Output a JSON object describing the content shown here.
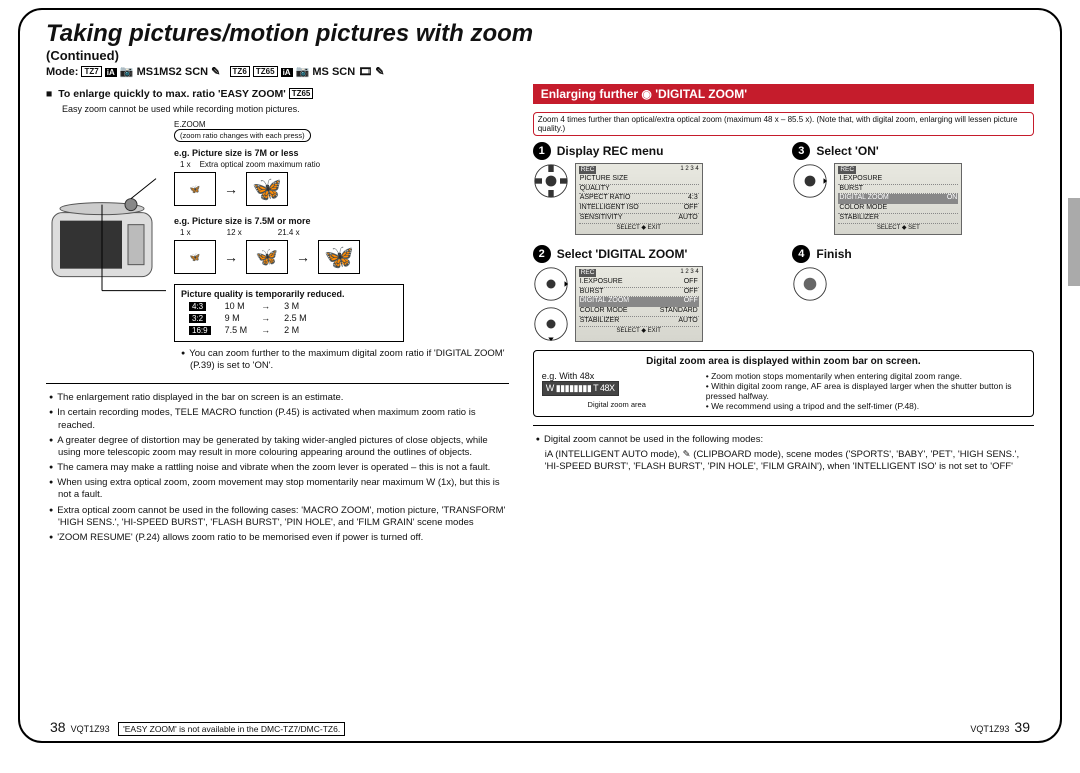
{
  "header": {
    "title": "Taking pictures/motion pictures with zoom",
    "continued": "(Continued)",
    "mode_label": "Mode:",
    "mode_set1": "MS1MS2 SCN",
    "mode_set2": "MS SCN"
  },
  "left": {
    "easy_zoom_title": "To enlarge quickly to max. ratio 'EASY ZOOM'",
    "easy_zoom_badge": "TZ65",
    "easy_zoom_note": "Easy zoom cannot be used while recording motion pictures.",
    "ezoom_label": "E.ZOOM",
    "zoom_ratio_note": "(zoom ratio changes with each press)",
    "eg1": "e.g. Picture size is 7M or less",
    "eg1_1x": "1 x",
    "eg1_cap": "Extra optical zoom maximum ratio",
    "eg2": "e.g. Picture size is 7.5M or more",
    "eg2_1": "1 x",
    "eg2_2": "12 x",
    "eg2_3": "21.4 x",
    "quality_title": "Picture quality is temporarily reduced.",
    "r1a": "4:3",
    "r1b": "10 M",
    "r1c": "→",
    "r1d": "3 M",
    "r2a": "3:2",
    "r2b": "9 M",
    "r2c": "→",
    "r2d": "2.5 M",
    "r3a": "16:9",
    "r3b": "7.5 M",
    "r3c": "→",
    "r3d": "2 M",
    "quality_bullet": "You can zoom further to the maximum digital zoom ratio if 'DIGITAL ZOOM' (P.39) is set to 'ON'.",
    "bl1": "The enlargement ratio displayed in the bar on screen is an estimate.",
    "bl2": "In certain recording modes, TELE MACRO function (P.45) is activated when maximum zoom ratio is reached.",
    "bl3": "A greater degree of distortion may be generated by taking wider-angled pictures of close objects, while using more telescopic zoom may result in more colouring appearing around the outlines of objects.",
    "bl4": "The camera may make a rattling noise and vibrate when the zoom lever is operated – this is not a fault.",
    "bl5": "When using extra optical zoom, zoom movement may stop momentarily near maximum W (1x), but this is not a fault.",
    "bl6": "Extra optical zoom cannot be used in the following cases: 'MACRO ZOOM', motion picture, 'TRANSFORM' 'HIGH SENS.', 'HI-SPEED BURST', 'FLASH BURST', 'PIN HOLE', and 'FILM GRAIN' scene modes",
    "bl7": "'ZOOM RESUME' (P.24) allows zoom ratio to be memorised even if power is turned off."
  },
  "right": {
    "bar_title": "Enlarging further ◉ 'DIGITAL ZOOM'",
    "redbox1": "Zoom 4 times further than optical/extra optical zoom (maximum 48 x – 85.5 x). (Note that, with digital zoom, enlarging will lessen picture quality.)",
    "step1": "Display REC menu",
    "step2": "Select 'DIGITAL ZOOM'",
    "step3": "Select 'ON'",
    "step4": "Finish",
    "lcd1": {
      "hdr": "REC",
      "pg": "1 2 3 4",
      "rows": [
        [
          "PICTURE SIZE",
          ""
        ],
        [
          "QUALITY",
          ""
        ],
        [
          "ASPECT RATIO",
          "4:3"
        ],
        [
          "INTELLIGENT ISO",
          "OFF"
        ],
        [
          "SENSITIVITY",
          "AUTO"
        ]
      ],
      "foot": "SELECT ◆ EXIT"
    },
    "lcd2": {
      "hdr": "REC",
      "pg": "1 2 3 4",
      "rows": [
        [
          "I.EXPOSURE",
          "OFF"
        ],
        [
          "BURST",
          "OFF"
        ],
        [
          "DIGITAL ZOOM",
          "OFF"
        ],
        [
          "COLOR MODE",
          "STANDARD"
        ],
        [
          "STABILIZER",
          "AUTO"
        ]
      ],
      "sel": 2,
      "foot": "SELECT ◆ EXIT"
    },
    "lcd3": {
      "hdr": "REC",
      "rows": [
        [
          "I.EXPOSURE",
          ""
        ],
        [
          "BURST",
          ""
        ],
        [
          "DIGITAL ZOOM",
          "ON"
        ],
        [
          "COLOR MODE",
          ""
        ],
        [
          "STABILIZER",
          ""
        ]
      ],
      "sel": 2,
      "foot": "SELECT ◆ SET"
    },
    "dig_title": "Digital zoom area is displayed within zoom bar on screen.",
    "dig_eg": "e.g. With 48x",
    "dig_bar": "W ▮▮▮▮▮▮▮▮ T 48X",
    "dig_caption": "Digital zoom area",
    "dig_b1": "Zoom motion stops momentarily when entering digital zoom range.",
    "dig_b2": "Within digital zoom range, AF area is displayed larger when the shutter button is pressed halfway.",
    "dig_b3": "We recommend using a tripod and the self-timer (P.48).",
    "bl1": "Digital zoom cannot be used in the following modes:",
    "bl1sub": "iA (INTELLIGENT AUTO mode), ✎ (CLIPBOARD mode), scene modes ('SPORTS', 'BABY', 'PET', 'HIGH SENS.', 'HI-SPEED BURST', 'FLASH BURST', 'PIN HOLE', 'FILM GRAIN'), when 'INTELLIGENT ISO' is not set to 'OFF'"
  },
  "footer": {
    "left_page": "38",
    "code_l": "VQT1Z93",
    "note": "'EASY ZOOM' is not available in the DMC-TZ7/DMC-TZ6.",
    "code_r": "VQT1Z93",
    "right_page": "39"
  }
}
